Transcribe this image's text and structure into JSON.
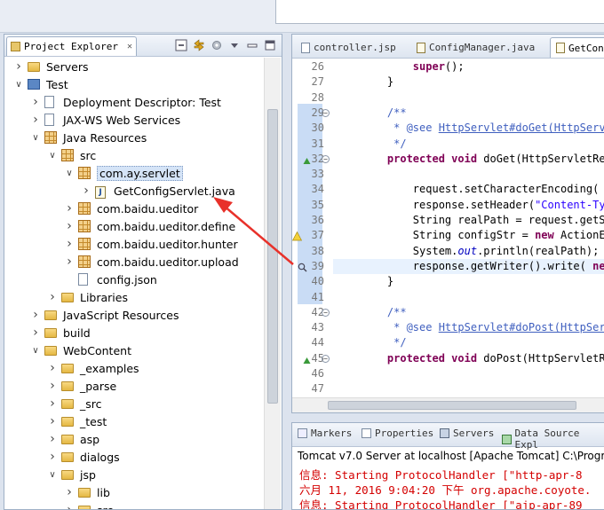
{
  "explorer": {
    "tab_label": "Project Explorer",
    "close_glyph": "✕"
  },
  "tree": [
    {
      "label": "Servers",
      "depth": 0,
      "toggle": ">",
      "icon": "folder"
    },
    {
      "label": "Test",
      "depth": 0,
      "toggle": "v",
      "icon": "project"
    },
    {
      "label": "Deployment Descriptor: Test",
      "depth": 1,
      "toggle": ">",
      "icon": "descriptor"
    },
    {
      "label": "JAX-WS Web Services",
      "depth": 1,
      "toggle": ">",
      "icon": "ws"
    },
    {
      "label": "Java Resources",
      "depth": 1,
      "toggle": "v",
      "icon": "jres"
    },
    {
      "label": "src",
      "depth": 2,
      "toggle": "v",
      "icon": "srcfolder"
    },
    {
      "label": "com.ay.servlet",
      "depth": 3,
      "toggle": "v",
      "icon": "package",
      "selected": true
    },
    {
      "label": "GetConfigServlet.java",
      "depth": 4,
      "toggle": ">",
      "icon": "java"
    },
    {
      "label": "com.baidu.ueditor",
      "depth": 3,
      "toggle": ">",
      "icon": "package"
    },
    {
      "label": "com.baidu.ueditor.define",
      "depth": 3,
      "toggle": ">",
      "icon": "package"
    },
    {
      "label": "com.baidu.ueditor.hunter",
      "depth": 3,
      "toggle": ">",
      "icon": "package"
    },
    {
      "label": "com.baidu.ueditor.upload",
      "depth": 3,
      "toggle": ">",
      "icon": "package"
    },
    {
      "label": "config.json",
      "depth": 3,
      "toggle": "",
      "icon": "file"
    },
    {
      "label": "Libraries",
      "depth": 2,
      "toggle": ">",
      "icon": "lib"
    },
    {
      "label": "JavaScript Resources",
      "depth": 1,
      "toggle": ">",
      "icon": "jsres"
    },
    {
      "label": "build",
      "depth": 1,
      "toggle": ">",
      "icon": "folder"
    },
    {
      "label": "WebContent",
      "depth": 1,
      "toggle": "v",
      "icon": "folder"
    },
    {
      "label": "_examples",
      "depth": 2,
      "toggle": ">",
      "icon": "folder"
    },
    {
      "label": "_parse",
      "depth": 2,
      "toggle": ">",
      "icon": "folder"
    },
    {
      "label": "_src",
      "depth": 2,
      "toggle": ">",
      "icon": "folder"
    },
    {
      "label": "_test",
      "depth": 2,
      "toggle": ">",
      "icon": "folder"
    },
    {
      "label": "asp",
      "depth": 2,
      "toggle": ">",
      "icon": "folder"
    },
    {
      "label": "dialogs",
      "depth": 2,
      "toggle": ">",
      "icon": "folder"
    },
    {
      "label": "jsp",
      "depth": 2,
      "toggle": "v",
      "icon": "folder"
    },
    {
      "label": "lib",
      "depth": 3,
      "toggle": ">",
      "icon": "folder"
    },
    {
      "label": "src",
      "depth": 3,
      "toggle": ">",
      "icon": "folder"
    }
  ],
  "editor": {
    "tabs": [
      "controller.jsp",
      "ConfigManager.java",
      "GetCon"
    ],
    "lines": [
      {
        "n": "26",
        "html": "        <span class='kw'>super</span>();"
      },
      {
        "n": "27",
        "html": "    }"
      },
      {
        "n": "28",
        "html": ""
      },
      {
        "n": "29",
        "html": "    <span class='cm'>/**</span>",
        "fold": "⊖"
      },
      {
        "n": "30",
        "html": "<span class='cm'>     * @see <span class='lnk'>HttpServlet#doGet(HttpServ</span></span>"
      },
      {
        "n": "31",
        "html": "<span class='cm'>     */</span>"
      },
      {
        "n": "32",
        "html": "    <span class='kw'>protected</span> <span class='kw'>void</span> doGet(HttpServletRe",
        "fold": "⊖",
        "overrides": true
      },
      {
        "n": "33",
        "html": ""
      },
      {
        "n": "34",
        "html": "        request.setCharacterEncoding("
      },
      {
        "n": "35",
        "html": "        response.setHeader(<span class='str'>\"Content-Ty</span>"
      },
      {
        "n": "36",
        "html": "        String realPath = request.getS"
      },
      {
        "n": "37",
        "html": "        String configStr = <span class='kw'>new</span> ActionE",
        "warn": true
      },
      {
        "n": "38",
        "html": "        System.<span class='fld'>out</span>.println(realPath);"
      },
      {
        "n": "39",
        "html": "        response.getWriter().write( <span class='kw'>ne</span>",
        "hl": true,
        "search": true
      },
      {
        "n": "40",
        "html": "    }"
      },
      {
        "n": "41",
        "html": ""
      },
      {
        "n": "42",
        "html": "    <span class='cm'>/**</span>",
        "fold": "⊖"
      },
      {
        "n": "43",
        "html": "<span class='cm'>     * @see <span class='lnk'>HttpServlet#doPost(HttpSer</span></span>"
      },
      {
        "n": "44",
        "html": "<span class='cm'>     */</span>"
      },
      {
        "n": "45",
        "html": "    <span class='kw'>protected</span> <span class='kw'>void</span> doPost(HttpServletRe",
        "fold": "⊖",
        "overrides": true
      },
      {
        "n": "46",
        "html": ""
      },
      {
        "n": "47",
        "html": ""
      }
    ]
  },
  "console": {
    "tabs": [
      "Markers",
      "Properties",
      "Servers",
      "Data Source Expl"
    ],
    "title": "Tomcat v7.0 Server at localhost [Apache Tomcat] C:\\Progra",
    "lines": [
      "信息: Starting ProtocolHandler [\"http-apr-8",
      "六月 11, 2016 9:04:20 下午 org.apache.coyote.",
      "信息: Starting ProtocolHandler [\"ajp-apr-89"
    ]
  },
  "colors": {
    "keyword": "#7f0055",
    "comment": "#3f5fbf",
    "string": "#2a00ff",
    "console_text": "#d40000",
    "arrow": "#e8312a"
  }
}
